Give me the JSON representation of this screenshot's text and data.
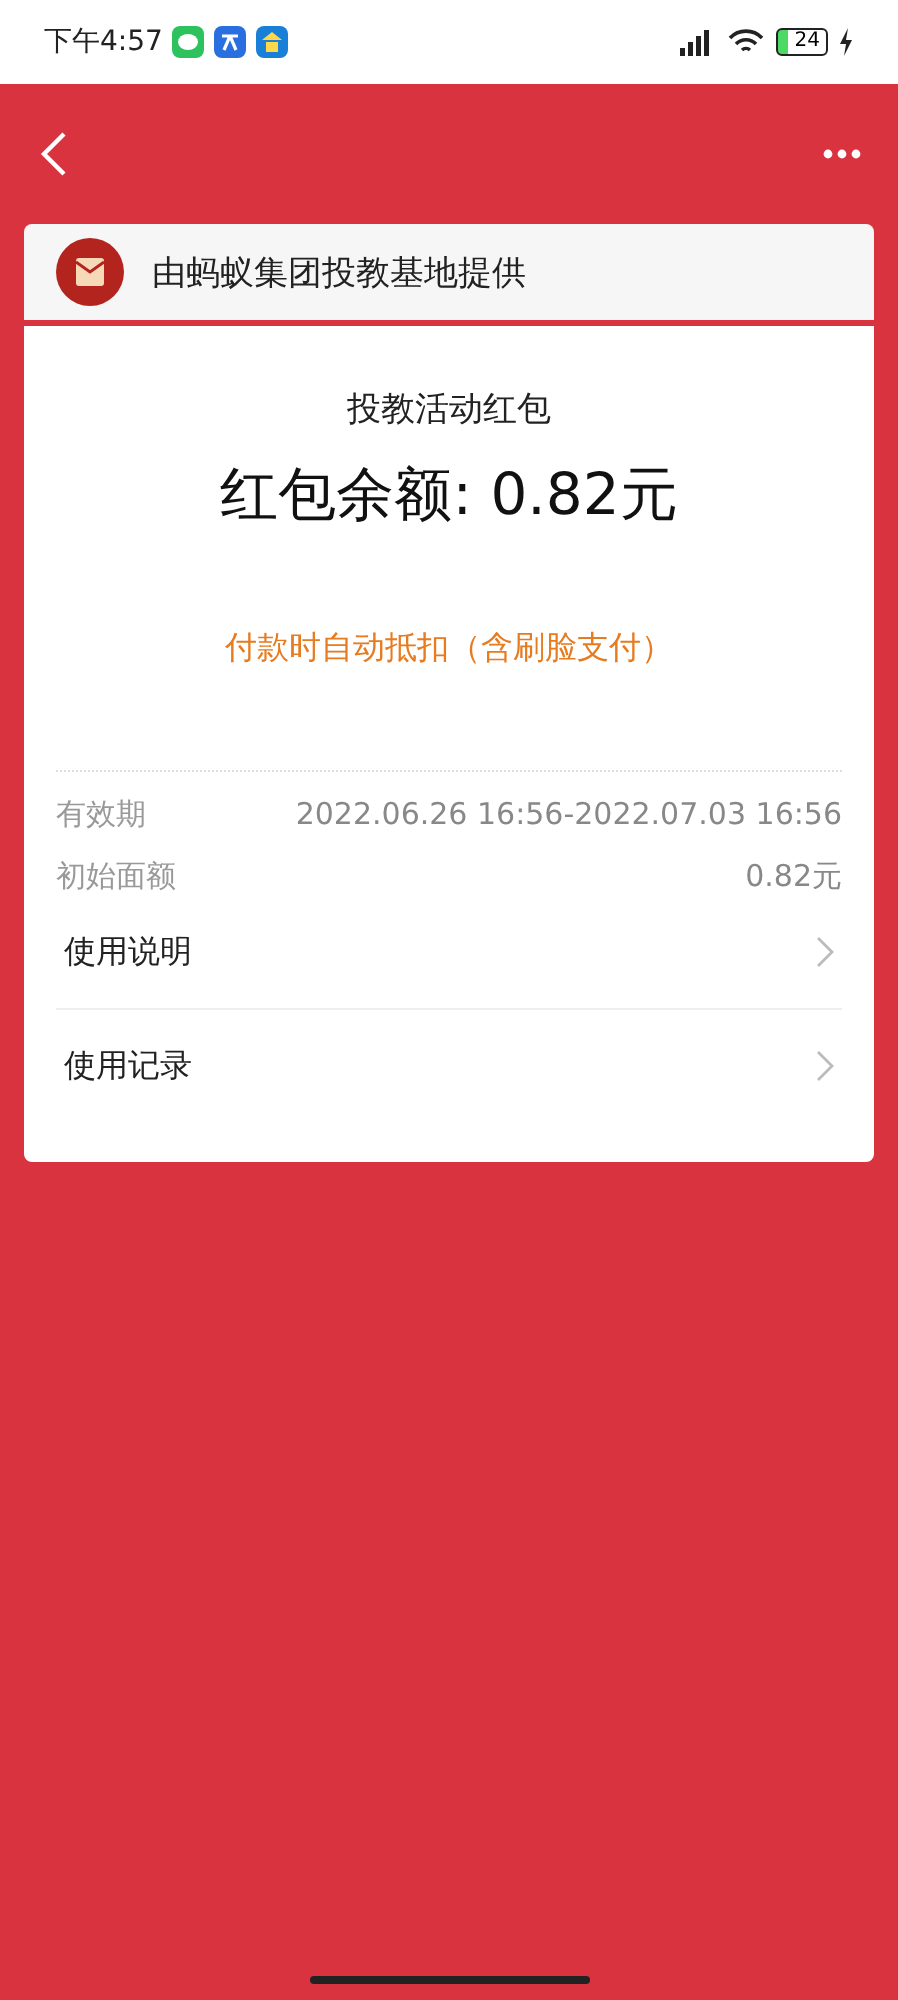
{
  "status_bar": {
    "time": "下午4:57",
    "battery": "24"
  },
  "provider": {
    "text": "由蚂蚁集团投教基地提供"
  },
  "card": {
    "title": "投教活动红包",
    "balance": "红包余额: 0.82元",
    "note": "付款时自动抵扣（含刷脸支付）",
    "details": [
      {
        "label": "有效期",
        "value": "2022.06.26 16:56-2022.07.03 16:56"
      },
      {
        "label": "初始面额",
        "value": "0.82元"
      }
    ],
    "links": [
      {
        "label": "使用说明"
      },
      {
        "label": "使用记录"
      }
    ]
  }
}
